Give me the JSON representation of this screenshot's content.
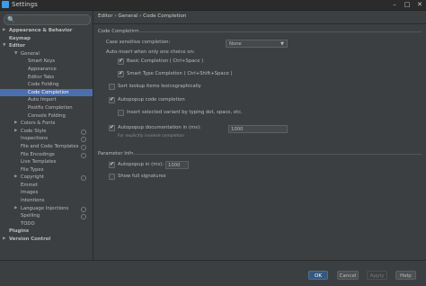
{
  "window": {
    "title": "Settings",
    "minimize": "–",
    "maximize": "□",
    "close": "✕"
  },
  "search": {
    "icon": "🔍",
    "value": ""
  },
  "tree": [
    {
      "label": "Appearance & Behavior",
      "depth": 0,
      "arrow": "▶",
      "bold": true
    },
    {
      "label": "Keymap",
      "depth": 0,
      "bold": true
    },
    {
      "label": "Editor",
      "depth": 0,
      "arrow": "▼",
      "bold": true
    },
    {
      "label": "General",
      "depth": 1,
      "arrow": "▼"
    },
    {
      "label": "Smart Keys",
      "depth": 2
    },
    {
      "label": "Appearance",
      "depth": 2
    },
    {
      "label": "Editor Tabs",
      "depth": 2
    },
    {
      "label": "Code Folding",
      "depth": 2
    },
    {
      "label": "Code Completion",
      "depth": 2,
      "selected": true
    },
    {
      "label": "Auto Import",
      "depth": 2
    },
    {
      "label": "Postfix Completion",
      "depth": 2
    },
    {
      "label": "Console Folding",
      "depth": 2
    },
    {
      "label": "Colors & Fonts",
      "depth": 1,
      "arrow": "▶"
    },
    {
      "label": "Code Style",
      "depth": 1,
      "arrow": "▶",
      "gear": true
    },
    {
      "label": "Inspections",
      "depth": 1,
      "gear": true
    },
    {
      "label": "File and Code Templates",
      "depth": 1,
      "gear": true
    },
    {
      "label": "File Encodings",
      "depth": 1,
      "gear": true
    },
    {
      "label": "Live Templates",
      "depth": 1
    },
    {
      "label": "File Types",
      "depth": 1
    },
    {
      "label": "Copyright",
      "depth": 1,
      "arrow": "▶",
      "gear": true
    },
    {
      "label": "Emmet",
      "depth": 1
    },
    {
      "label": "Images",
      "depth": 1
    },
    {
      "label": "Intentions",
      "depth": 1
    },
    {
      "label": "Language Injections",
      "depth": 1,
      "arrow": "▶",
      "gear": true
    },
    {
      "label": "Spelling",
      "depth": 1,
      "gear": true
    },
    {
      "label": "TODO",
      "depth": 1
    },
    {
      "label": "Plugins",
      "depth": 0,
      "bold": true
    },
    {
      "label": "Version Control",
      "depth": 0,
      "arrow": "▶",
      "bold": true
    }
  ],
  "breadcrumb": "Editor › General › Code Completion",
  "code_completion": {
    "section": "Code Completion",
    "case_sensitive_label": "Case sensitive completion:",
    "case_sensitive_value": "None",
    "auto_insert_label": "Auto-insert when only one choice on:",
    "basic_completion": {
      "label": "Basic Completion ( Ctrl+Space )",
      "checked": true
    },
    "smart_completion": {
      "label": "Smart Type Completion ( Ctrl+Shift+Space )",
      "checked": true
    },
    "sort_lex": {
      "label": "Sort lookup items lexicographically",
      "checked": false
    },
    "autopopup": {
      "label": "Autopopup code completion",
      "checked": true
    },
    "insert_selected": {
      "label": "Insert selected variant by typing dot, space, etc.",
      "checked": false
    },
    "autopopup_doc": {
      "label": "Autopopup documentation in (ms):",
      "checked": true,
      "value": "1000"
    },
    "explicit_note": "For explicitly invoked completion"
  },
  "parameter_info": {
    "section": "Parameter Info",
    "autopopup": {
      "label": "Autopopup in (ms):",
      "checked": true,
      "value": "1000"
    },
    "full_signatures": {
      "label": "Show full signatures",
      "checked": false
    }
  },
  "buttons": {
    "ok": "OK",
    "cancel": "Cancel",
    "apply": "Apply",
    "help": "Help"
  },
  "check_glyph": "✔"
}
